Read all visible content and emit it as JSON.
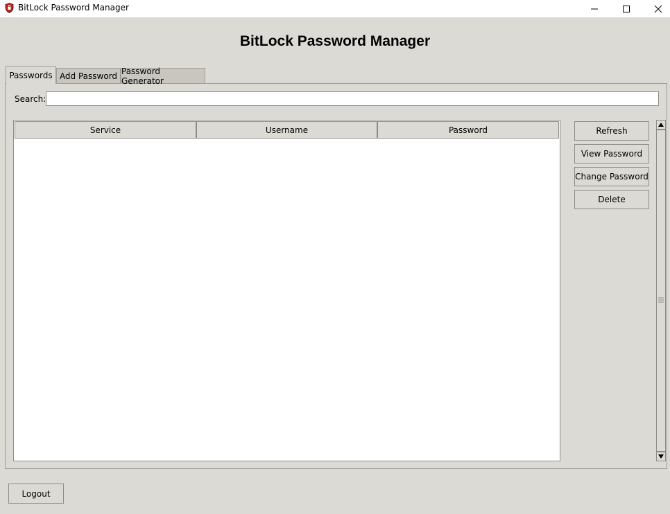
{
  "window": {
    "title": "BitLock Password Manager",
    "icon": "shield-icon",
    "controls": [
      "minimize-icon",
      "maximize-icon",
      "close-icon"
    ]
  },
  "header": {
    "title": "BitLock Password Manager"
  },
  "tabs": [
    {
      "label": "Passwords",
      "active": true
    },
    {
      "label": "Add Password",
      "active": false
    },
    {
      "label": "Password Generator",
      "active": false
    }
  ],
  "search": {
    "label": "Search:",
    "value": "",
    "placeholder": ""
  },
  "table": {
    "columns": [
      "Service",
      "Username",
      "Password"
    ],
    "rows": []
  },
  "actions": {
    "refresh": "Refresh",
    "view": "View Password",
    "change": "Change Password",
    "delete": "Delete"
  },
  "footer": {
    "logout": "Logout"
  },
  "colors": {
    "background": "#dcdad5",
    "accent": "#c0392b"
  }
}
